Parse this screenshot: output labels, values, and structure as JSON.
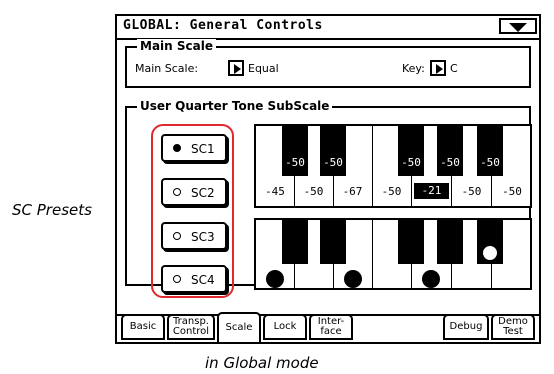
{
  "window": {
    "title": "GLOBAL: General Controls"
  },
  "main_scale": {
    "group_label": "Main Scale",
    "scale_label": "Main Scale:",
    "scale_value": "Equal",
    "key_label": "Key:",
    "key_value": "C"
  },
  "subscale": {
    "group_label": "User Quarter Tone SubScale",
    "presets": [
      {
        "label": "SC1",
        "selected": true
      },
      {
        "label": "SC2",
        "selected": false
      },
      {
        "label": "SC3",
        "selected": false
      },
      {
        "label": "SC4",
        "selected": false
      }
    ],
    "black_key_values": [
      "-50",
      "-50",
      "-50",
      "-50",
      "-50"
    ],
    "white_key_values": [
      "-45",
      "-50",
      "-67",
      "-50",
      "-21",
      "-50",
      "-50"
    ],
    "selected_white_index": 4
  },
  "tabs": [
    {
      "label": "Basic"
    },
    {
      "label": "Transp. Control"
    },
    {
      "label": "Scale",
      "active": true
    },
    {
      "label": "Lock"
    },
    {
      "label": "Inter- face"
    },
    {
      "label": "Debug"
    },
    {
      "label": "Demo Test"
    }
  ],
  "callout": {
    "text": "SC Presets",
    "highlight_color": "#e0282d"
  },
  "caption": "in Global mode"
}
